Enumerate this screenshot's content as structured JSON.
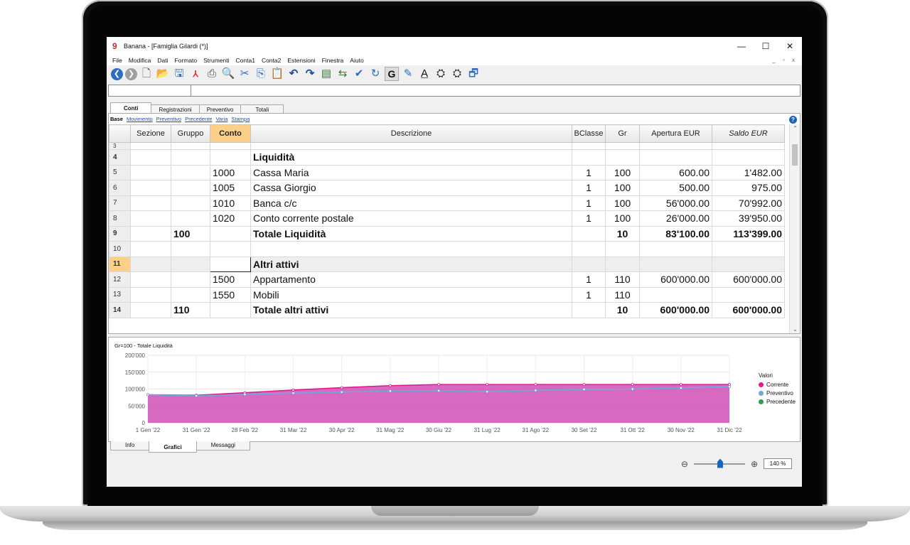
{
  "window": {
    "app_logo": "9",
    "title": "Banana - [Famiglia Gilardi (*)]",
    "controls": [
      "—",
      "☐",
      "✕"
    ]
  },
  "menu": [
    "File",
    "Modifica",
    "Dati",
    "Formato",
    "Strumenti",
    "Conta1",
    "Conta2",
    "Estensioni",
    "Finestra",
    "Aiuto"
  ],
  "mdi_controls": "_ ▫ x",
  "toolbar_icons": [
    "back-icon",
    "forward-icon",
    "new-file-icon",
    "open-folder-icon",
    "save-icon",
    "pdf-icon",
    "print-icon",
    "print-preview-icon",
    "cut-icon",
    "copy-icon",
    "paste-icon",
    "undo-icon",
    "redo-icon",
    "insert-rows-icon",
    "move-rows-icon",
    "check-accounting-icon",
    "recheck-icon",
    "bold-icon",
    "highlight-icon",
    "font-color-icon",
    "find-icon",
    "replace-icon",
    "window-icon"
  ],
  "tabs": [
    "Conti",
    "Registrazioni",
    "Preventivo",
    "Totali"
  ],
  "views": [
    "Base",
    "Movimento",
    "Preventivo",
    "Precedente",
    "Varia",
    "Stampa"
  ],
  "help_label": "?",
  "table": {
    "headers": [
      "Sezione",
      "Gruppo",
      "Conto",
      "Descrizione",
      "BClasse",
      "Gr",
      "Apertura EUR",
      "Saldo EUR"
    ],
    "rows": [
      [
        "3",
        "",
        "",
        "",
        "",
        "",
        "",
        "",
        ""
      ],
      [
        "4",
        "",
        "",
        "",
        "Liquidità",
        "",
        "",
        "",
        ""
      ],
      [
        "5",
        "",
        "",
        "1000",
        "Cassa Maria",
        "1",
        "100",
        "600.00",
        "1'482.00"
      ],
      [
        "6",
        "",
        "",
        "1005",
        "Cassa Giorgio",
        "1",
        "100",
        "500.00",
        "975.00"
      ],
      [
        "7",
        "",
        "",
        "1010",
        "Banca c/c",
        "1",
        "100",
        "56'000.00",
        "70'992.00"
      ],
      [
        "8",
        "",
        "",
        "1020",
        "Conto corrente postale",
        "1",
        "100",
        "26'000.00",
        "39'950.00"
      ],
      [
        "9",
        "",
        "100",
        "",
        "Totale Liquidità",
        "",
        "10",
        "83'100.00",
        "113'399.00"
      ],
      [
        "10",
        "",
        "",
        "",
        "",
        "",
        "",
        "",
        ""
      ],
      [
        "11",
        "",
        "",
        "",
        "Altri attivi",
        "",
        "",
        "",
        ""
      ],
      [
        "12",
        "",
        "",
        "1500",
        "Appartamento",
        "1",
        "110",
        "600'000.00",
        "600'000.00"
      ],
      [
        "13",
        "",
        "",
        "1550",
        "Mobili",
        "1",
        "110",
        "",
        ""
      ],
      [
        "14",
        "",
        "110",
        "",
        "Totale altri attivi",
        "",
        "10",
        "600'000.00",
        "600'000.00"
      ]
    ]
  },
  "chart_data": {
    "type": "area",
    "title": "Gr=100 - Totale Liquidità",
    "x": [
      "1 Gen '22",
      "31 Gen '22",
      "28 Feb '22",
      "31 Mar '22",
      "30 Apr '22",
      "31 Mag '22",
      "30 Giu '22",
      "31 Lug '22",
      "31 Ago '22",
      "30 Set '22",
      "31 Ott '22",
      "30 Nov '22",
      "31 Dic '22"
    ],
    "ylim": [
      0,
      200000
    ],
    "y_ticks": [
      "200'000",
      "150'000",
      "100'000",
      "50'000",
      "0"
    ],
    "y_tick_values": [
      200000,
      150000,
      100000,
      50000,
      0
    ],
    "legend_title": "Valori",
    "legend_position": "right",
    "grid": true,
    "series": [
      {
        "name": "Corrente",
        "color": "#e8168c",
        "values": [
          83100,
          81500,
          89000,
          97000,
          104000,
          110000,
          113399,
          113399,
          113399,
          113399,
          113399,
          113399,
          113399
        ]
      },
      {
        "name": "Preventivo",
        "color": "#6fa8dc",
        "values": [
          83100,
          80000,
          84000,
          88000,
          91000,
          94000,
          95000,
          92000,
          96000,
          99000,
          100000,
          103000,
          107000
        ]
      },
      {
        "name": "Precedente",
        "color": "#2e9e4a",
        "values": []
      }
    ]
  },
  "bottom_tabs": [
    "Info",
    "Grafici",
    "Messaggi"
  ],
  "zoom": {
    "out_icon": "⊖",
    "in_icon": "⊕",
    "value": "140 %",
    "level": 0.5
  }
}
